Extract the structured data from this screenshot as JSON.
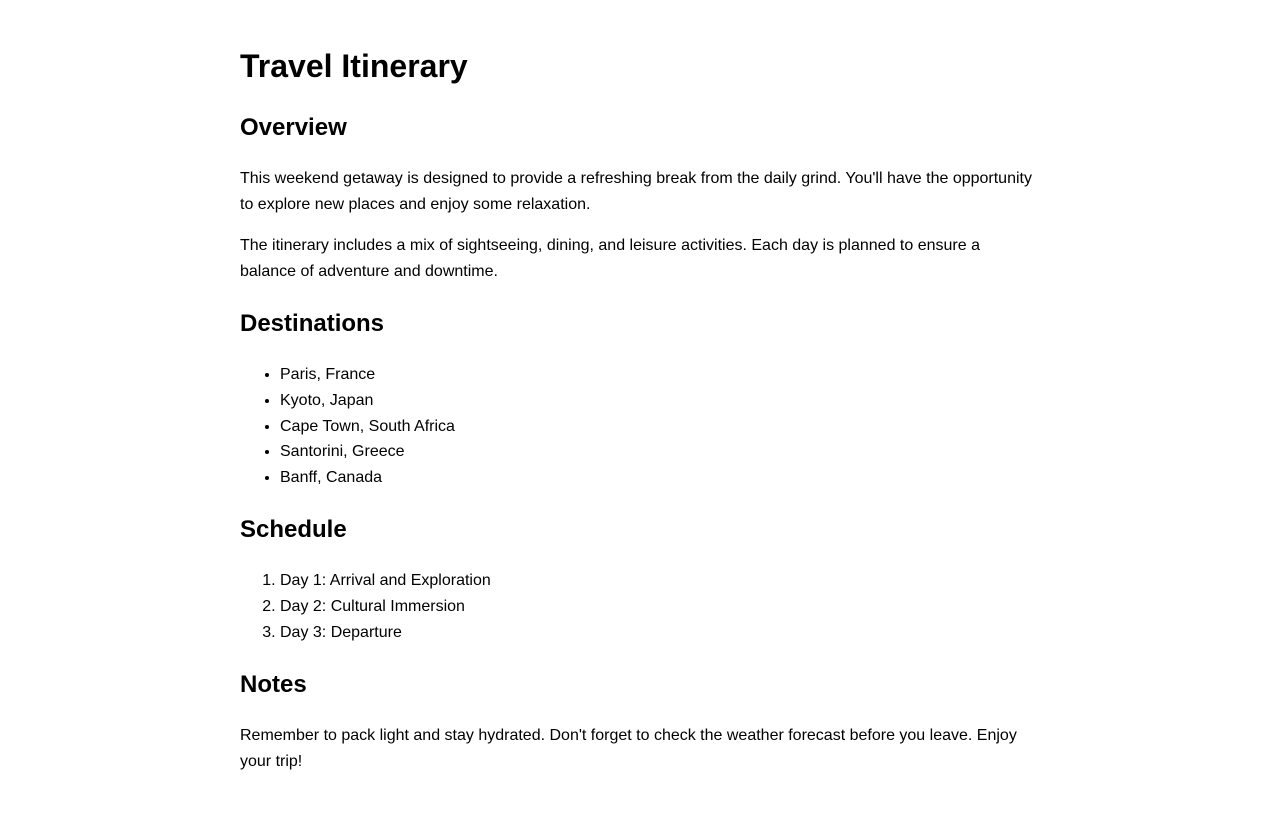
{
  "title": "Travel Itinerary",
  "overview": {
    "heading": "Overview",
    "paragraphs": [
      "This weekend getaway is designed to provide a refreshing break from the daily grind. You'll have the opportunity to explore new places and enjoy some relaxation.",
      "The itinerary includes a mix of sightseeing, dining, and leisure activities. Each day is planned to ensure a balance of adventure and downtime."
    ]
  },
  "destinations": {
    "heading": "Destinations",
    "items": [
      "Paris, France",
      "Kyoto, Japan",
      "Cape Town, South Africa",
      "Santorini, Greece",
      "Banff, Canada"
    ]
  },
  "schedule": {
    "heading": "Schedule",
    "items": [
      "Day 1: Arrival and Exploration",
      "Day 2: Cultural Immersion",
      "Day 3: Departure"
    ]
  },
  "notes": {
    "heading": "Notes",
    "text": "Remember to pack light and stay hydrated. Don't forget to check the weather forecast before you leave. Enjoy your trip!"
  }
}
